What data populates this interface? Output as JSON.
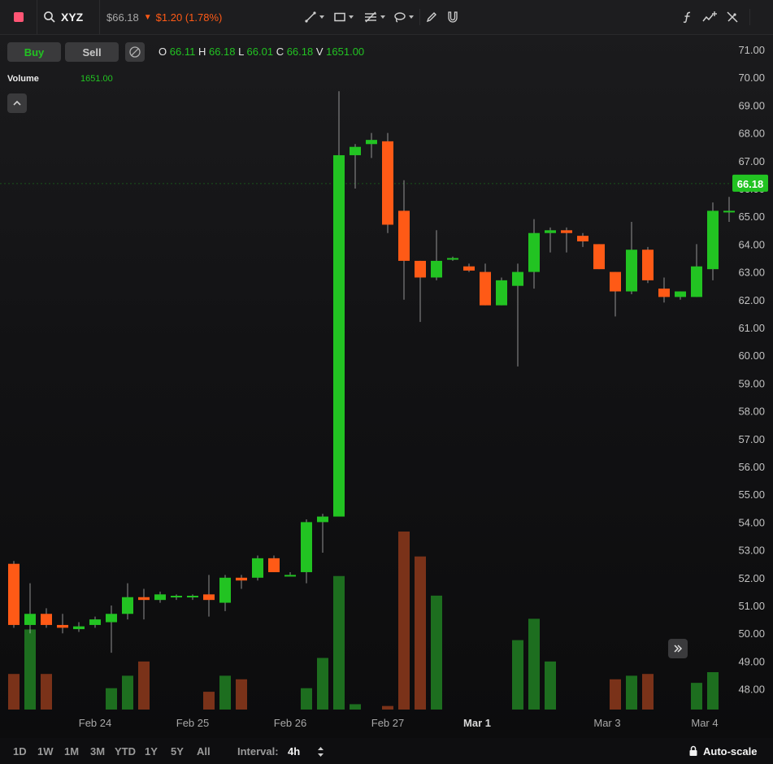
{
  "app": {
    "symbol": "XYZ",
    "price": "$66.18",
    "change": "$1.20 (1.78%)"
  },
  "toolbar": {
    "buy_label": "Buy",
    "sell_label": "Sell"
  },
  "ohlc": {
    "o_key": "O",
    "o_val": "66.11",
    "h_key": "H",
    "h_val": "66.18",
    "l_key": "L",
    "l_val": "66.01",
    "c_key": "C",
    "c_val": "66.18",
    "v_key": "V",
    "v_val": "1651.00"
  },
  "volume": {
    "label": "Volume",
    "value": "1651.00"
  },
  "bottom": {
    "ranges": [
      "1D",
      "1W",
      "1M",
      "3M",
      "YTD",
      "1Y",
      "5Y",
      "All"
    ],
    "interval_label": "Interval:",
    "interval_value": "4h",
    "autoscale_label": "Auto-scale"
  },
  "colors": {
    "up": "#22c322",
    "down": "#ff5a16",
    "up_volume": "#1d6e1f",
    "down_volume": "#7a3219",
    "price_label_bg": "#22c322"
  },
  "chart_data": {
    "type": "candlestick",
    "last_price_label": "66.18",
    "yticks": [
      "71.00",
      "70.00",
      "69.00",
      "68.00",
      "67.00",
      "66.00",
      "65.00",
      "64.00",
      "63.00",
      "62.00",
      "61.00",
      "60.00",
      "59.00",
      "58.00",
      "57.00",
      "56.00",
      "55.00",
      "54.00",
      "53.00",
      "52.00",
      "51.00",
      "50.00",
      "49.00",
      "48.00"
    ],
    "ylim": [
      47.3,
      71.8
    ],
    "x_labels": [
      {
        "label": "Feb 24",
        "index": 5,
        "bold": false
      },
      {
        "label": "Feb 25",
        "index": 11,
        "bold": false
      },
      {
        "label": "Feb 26",
        "index": 17,
        "bold": false
      },
      {
        "label": "Feb 27",
        "index": 23,
        "bold": false
      },
      {
        "label": "Mar 1",
        "index": 28.5,
        "bold": true
      },
      {
        "label": "Mar 3",
        "index": 36.5,
        "bold": false
      },
      {
        "label": "Mar 4",
        "index": 42.5,
        "bold": false
      }
    ],
    "candles": [
      {
        "o": 52.5,
        "h": 52.6,
        "l": 50.2,
        "c": 50.3,
        "v": 0.2
      },
      {
        "o": 50.3,
        "h": 51.8,
        "l": 50.0,
        "c": 50.7,
        "v": 0.45
      },
      {
        "o": 50.7,
        "h": 50.9,
        "l": 50.2,
        "c": 50.3,
        "v": 0.2
      },
      {
        "o": 50.3,
        "h": 50.7,
        "l": 50.0,
        "c": 50.2,
        "v": 0.0
      },
      {
        "o": 50.15,
        "h": 50.4,
        "l": 50.05,
        "c": 50.25,
        "v": 0.0
      },
      {
        "o": 50.3,
        "h": 50.6,
        "l": 50.2,
        "c": 50.5,
        "v": 0.0
      },
      {
        "o": 50.4,
        "h": 51.0,
        "l": 49.3,
        "c": 50.7,
        "v": 0.12
      },
      {
        "o": 50.7,
        "h": 51.8,
        "l": 50.5,
        "c": 51.3,
        "v": 0.19
      },
      {
        "o": 51.3,
        "h": 51.6,
        "l": 50.5,
        "c": 51.2,
        "v": 0.27
      },
      {
        "o": 51.2,
        "h": 51.5,
        "l": 51.1,
        "c": 51.4,
        "v": 0.0
      },
      {
        "o": 51.3,
        "h": 51.4,
        "l": 51.2,
        "c": 51.35,
        "v": 0.0
      },
      {
        "o": 51.3,
        "h": 51.4,
        "l": 51.2,
        "c": 51.35,
        "v": 0.0
      },
      {
        "o": 51.4,
        "h": 52.1,
        "l": 50.6,
        "c": 51.2,
        "v": 0.1
      },
      {
        "o": 51.1,
        "h": 52.1,
        "l": 50.8,
        "c": 52.0,
        "v": 0.19
      },
      {
        "o": 52.0,
        "h": 52.1,
        "l": 51.6,
        "c": 51.9,
        "v": 0.17
      },
      {
        "o": 52.0,
        "h": 52.8,
        "l": 51.9,
        "c": 52.7,
        "v": 0.0
      },
      {
        "o": 52.7,
        "h": 52.8,
        "l": 52.2,
        "c": 52.2,
        "v": 0.0
      },
      {
        "o": 52.1,
        "h": 52.2,
        "l": 52.1,
        "c": 52.1,
        "v": 0.0
      },
      {
        "o": 52.2,
        "h": 54.1,
        "l": 51.8,
        "c": 54.0,
        "v": 0.12
      },
      {
        "o": 54.0,
        "h": 54.3,
        "l": 52.9,
        "c": 54.2,
        "v": 0.29
      },
      {
        "o": 54.2,
        "h": 69.5,
        "l": 54.2,
        "c": 67.2,
        "v": 0.75
      },
      {
        "o": 67.2,
        "h": 67.6,
        "l": 66.0,
        "c": 67.5,
        "v": 0.03
      },
      {
        "o": 67.6,
        "h": 68.0,
        "l": 67.1,
        "c": 67.75,
        "v": 0.0
      },
      {
        "o": 67.7,
        "h": 68.0,
        "l": 64.4,
        "c": 64.7,
        "v": 0.02
      },
      {
        "o": 65.2,
        "h": 66.3,
        "l": 62.0,
        "c": 63.4,
        "v": 1.0
      },
      {
        "o": 63.4,
        "h": 63.4,
        "l": 61.2,
        "c": 62.8,
        "v": 0.86
      },
      {
        "o": 62.8,
        "h": 64.5,
        "l": 62.7,
        "c": 63.4,
        "v": 0.64
      },
      {
        "o": 63.45,
        "h": 63.55,
        "l": 63.4,
        "c": 63.5,
        "v": 0.0
      },
      {
        "o": 63.2,
        "h": 63.3,
        "l": 63.0,
        "c": 63.05,
        "v": 0.0
      },
      {
        "o": 63.0,
        "h": 63.3,
        "l": 61.8,
        "c": 61.8,
        "v": 0.0
      },
      {
        "o": 61.8,
        "h": 62.8,
        "l": 61.8,
        "c": 62.7,
        "v": 0.0
      },
      {
        "o": 62.5,
        "h": 63.3,
        "l": 59.6,
        "c": 63.0,
        "v": 0.39
      },
      {
        "o": 63.0,
        "h": 64.9,
        "l": 62.4,
        "c": 64.4,
        "v": 0.51
      },
      {
        "o": 64.4,
        "h": 64.6,
        "l": 63.7,
        "c": 64.5,
        "v": 0.27
      },
      {
        "o": 64.5,
        "h": 64.6,
        "l": 63.7,
        "c": 64.4,
        "v": 0.0
      },
      {
        "o": 64.3,
        "h": 64.4,
        "l": 63.9,
        "c": 64.1,
        "v": 0.0
      },
      {
        "o": 64.0,
        "h": 64.0,
        "l": 63.1,
        "c": 63.1,
        "v": 0.0
      },
      {
        "o": 63.0,
        "h": 63.0,
        "l": 61.4,
        "c": 62.3,
        "v": 0.17
      },
      {
        "o": 62.3,
        "h": 64.8,
        "l": 62.2,
        "c": 63.8,
        "v": 0.19
      },
      {
        "o": 63.8,
        "h": 63.9,
        "l": 62.6,
        "c": 62.7,
        "v": 0.2
      },
      {
        "o": 62.4,
        "h": 62.8,
        "l": 61.9,
        "c": 62.1,
        "v": 0.0
      },
      {
        "o": 62.1,
        "h": 62.3,
        "l": 62.0,
        "c": 62.3,
        "v": 0.0
      },
      {
        "o": 62.1,
        "h": 64.0,
        "l": 62.1,
        "c": 63.2,
        "v": 0.15
      },
      {
        "o": 63.1,
        "h": 65.5,
        "l": 62.7,
        "c": 65.2,
        "v": 0.21
      },
      {
        "o": 65.2,
        "h": 65.7,
        "l": 64.8,
        "c": 65.2,
        "v": 0.0
      }
    ]
  }
}
